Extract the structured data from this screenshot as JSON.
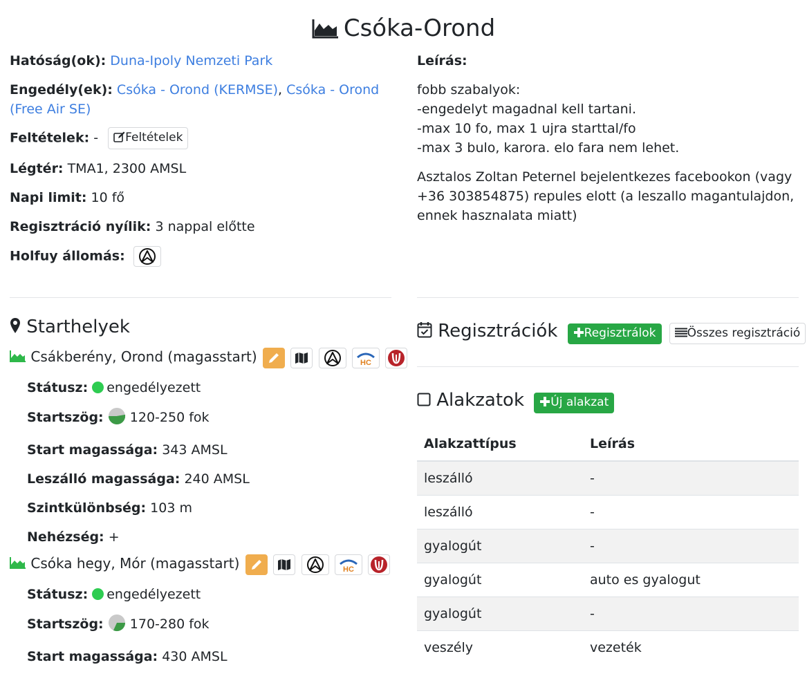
{
  "title": "Csóka-Orond",
  "left": {
    "authority_label": "Hatóság(ok):",
    "authority_link": "Duna-Ipoly Nemzeti Park",
    "permits_label": "Engedély(ek):",
    "permit1": "Csóka - Orond (KERMSE)",
    "permit_sep": ",",
    "permit2": "Csóka - Orond (Free Air SE)",
    "conditions_label": "Feltételek:",
    "conditions_value": "-",
    "conditions_button": "Feltételek",
    "airspace_label": "Légtér:",
    "airspace_value": "TMA1, 2300 AMSL",
    "daily_limit_label": "Napi limit:",
    "daily_limit_value": "10 fő",
    "registration_opens_label": "Regisztráció nyílik:",
    "registration_opens_value": "3 nappal előtte",
    "holfuy_label": "Holfuy állomás:"
  },
  "right": {
    "description_label": "Leírás:",
    "description_lines": [
      "fobb szabalyok:",
      "-engedelyt magadnal kell tartani.",
      "-max 10 fo, max 1 ujra starttal/fo",
      "-max 3 bulo, karora. elo fara nem lehet."
    ],
    "description_para2_line1": "Asztalos Zoltan Peternel bejelentkezes facebookon (vagy",
    "description_para2_line2": "+36 303854875) repules elott (a leszallo magantulajdon,",
    "description_para2_line3": "ennek hasznalata miatt)"
  },
  "starthelyek": {
    "title": "Starthelyek",
    "sites": [
      {
        "name": "Csákberény, Orond (magasstart)",
        "status_label": "Státusz:",
        "status_value": "engedélyezett",
        "angle_label": "Startszög:",
        "angle_value": "120-250 fok",
        "start_alt_label": "Start magassága:",
        "start_alt_value": "343 AMSL",
        "landing_alt_label": "Leszálló magassága:",
        "landing_alt_value": "240 AMSL",
        "diff_label": "Szintkülönbség:",
        "diff_value": "103 m",
        "difficulty_label": "Nehézség:",
        "difficulty_value": "+"
      },
      {
        "name": "Csóka hegy, Mór (magasstart)",
        "status_label": "Státusz:",
        "status_value": "engedélyezett",
        "angle_label": "Startszög:",
        "angle_value": "170-280 fok",
        "start_alt_label": "Start magassága:",
        "start_alt_value": "430 AMSL"
      }
    ]
  },
  "registrations": {
    "title": "Regisztrációk",
    "register_button": "Regisztrálok",
    "all_button": "Összes regisztráció"
  },
  "shapes": {
    "title": "Alakzatok",
    "new_button": "Új alakzat",
    "columns": [
      "Alakzattípus",
      "Leírás"
    ],
    "rows": [
      [
        "leszálló",
        "-"
      ],
      [
        "leszálló",
        "-"
      ],
      [
        "gyalogút",
        "-"
      ],
      [
        "gyalogút",
        "auto es gyalogut"
      ],
      [
        "gyalogút",
        "-"
      ],
      [
        "veszély",
        "vezeték"
      ]
    ]
  },
  "colors": {
    "link": "#3d7ee0",
    "green_button": "#28a745",
    "status_dot": "#2ecc51",
    "edit_button": "#f0ad4e",
    "site_icon": "#2eb84a"
  },
  "icons": [
    "mountain-icon",
    "map-pin-icon",
    "calendar-check-icon",
    "square-icon",
    "plus-icon",
    "list-icon",
    "edit-icon",
    "pencil-icon",
    "map-icon",
    "holfuy-icon",
    "hc-icon",
    "xc-icon",
    "pie-icon",
    "dot-icon"
  ]
}
